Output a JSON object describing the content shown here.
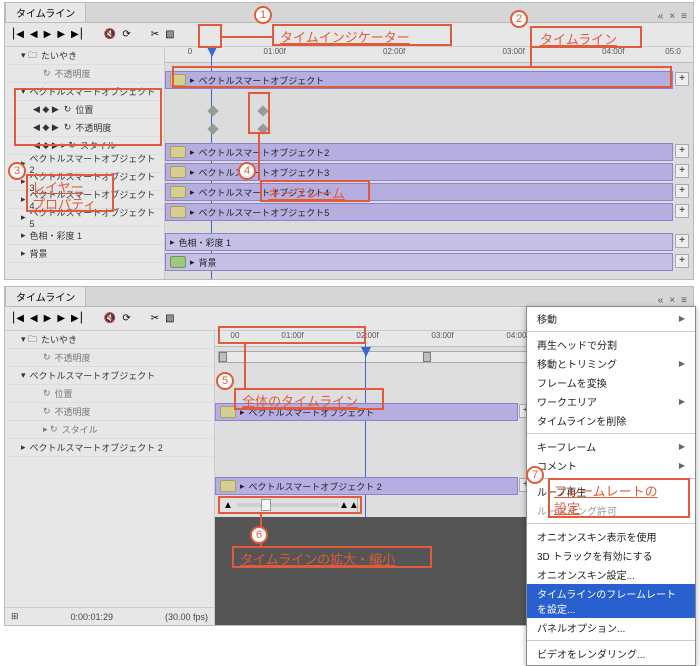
{
  "annotations": {
    "a1": "タイムインジケーター",
    "a2": "タイムライン",
    "a3a": "レイヤー",
    "a3b": "プロパティ",
    "a4": "キーフレーム",
    "a5": "全体のタイムライン",
    "a6": "タイムラインの拡大・縮小",
    "a7a": "フレームレートの",
    "a7b": "設定"
  },
  "top": {
    "tab": "タイムライン",
    "ruler": [
      "0",
      "01:00f",
      "02:00f",
      "03:00f",
      "04:00f",
      "05:0"
    ],
    "layers": {
      "root": "たいやき",
      "opacity": "不透明度",
      "v1": "ベクトルスマートオブジェクト",
      "pos": "位置",
      "opac": "不透明度",
      "style": "スタイル",
      "v2": "ベクトルスマートオブジェクト2",
      "v3": "ベクトルスマートオブジェクト3",
      "v4": "ベクトルスマートオブジェクト4",
      "v5": "ベクトルスマートオブジェクト5",
      "hue": "色相・彩度 1",
      "bg": "背景"
    },
    "tracks": {
      "t1": "ベクトルスマートオブジェクト",
      "t2": "ベクトルスマートオブジェクト2",
      "t3": "ベクトルスマートオブジェクト3",
      "t4": "ベクトルスマートオブジェクト4",
      "t5": "ベクトルスマートオブジェクト5",
      "thue": "色相・彩度 1",
      "tbg": "背景"
    }
  },
  "bot": {
    "tab": "タイムライン",
    "ruler": [
      "00",
      "01:00f",
      "02:00f",
      "03:00f",
      "04:00f"
    ],
    "layers": {
      "root": "たいやき",
      "opacity": "不透明度",
      "v1": "ベクトルスマートオブジェクト",
      "pos": "位置",
      "opac": "不透明度",
      "style": "スタイル",
      "v2": "ベクトルスマートオブジェクト 2"
    },
    "tracks": {
      "t1": "ベクトルスマートオブジェクト",
      "t2": "ベクトルスマートオブジェクト 2"
    },
    "time": "0:00:01:29",
    "fps": "(30.00 fps)"
  },
  "menu": [
    {
      "label": "移動",
      "arrow": true
    },
    {
      "sep": true
    },
    {
      "label": "再生ヘッドで分割"
    },
    {
      "label": "移動とトリミング",
      "arrow": true
    },
    {
      "label": "フレームを変換"
    },
    {
      "label": "ワークエリア",
      "arrow": true
    },
    {
      "label": "タイムラインを削除"
    },
    {
      "sep": true
    },
    {
      "label": "キーフレーム",
      "arrow": true
    },
    {
      "label": "コメント",
      "arrow": true
    },
    {
      "sep": true
    },
    {
      "label": "ループ再生"
    },
    {
      "label": "ルーマチング許可",
      "disabled": true
    },
    {
      "sep": true
    },
    {
      "label": "オニオンスキン表示を使用"
    },
    {
      "label": "3D トラックを有効にする"
    },
    {
      "label": "オニオンスキン設定..."
    },
    {
      "label": "タイムラインのフレームレートを設定...",
      "selected": true
    },
    {
      "label": "パネルオプション..."
    },
    {
      "sep": true
    },
    {
      "label": "ビデオをレンダリング..."
    }
  ],
  "icons": {
    "plus": "+"
  }
}
